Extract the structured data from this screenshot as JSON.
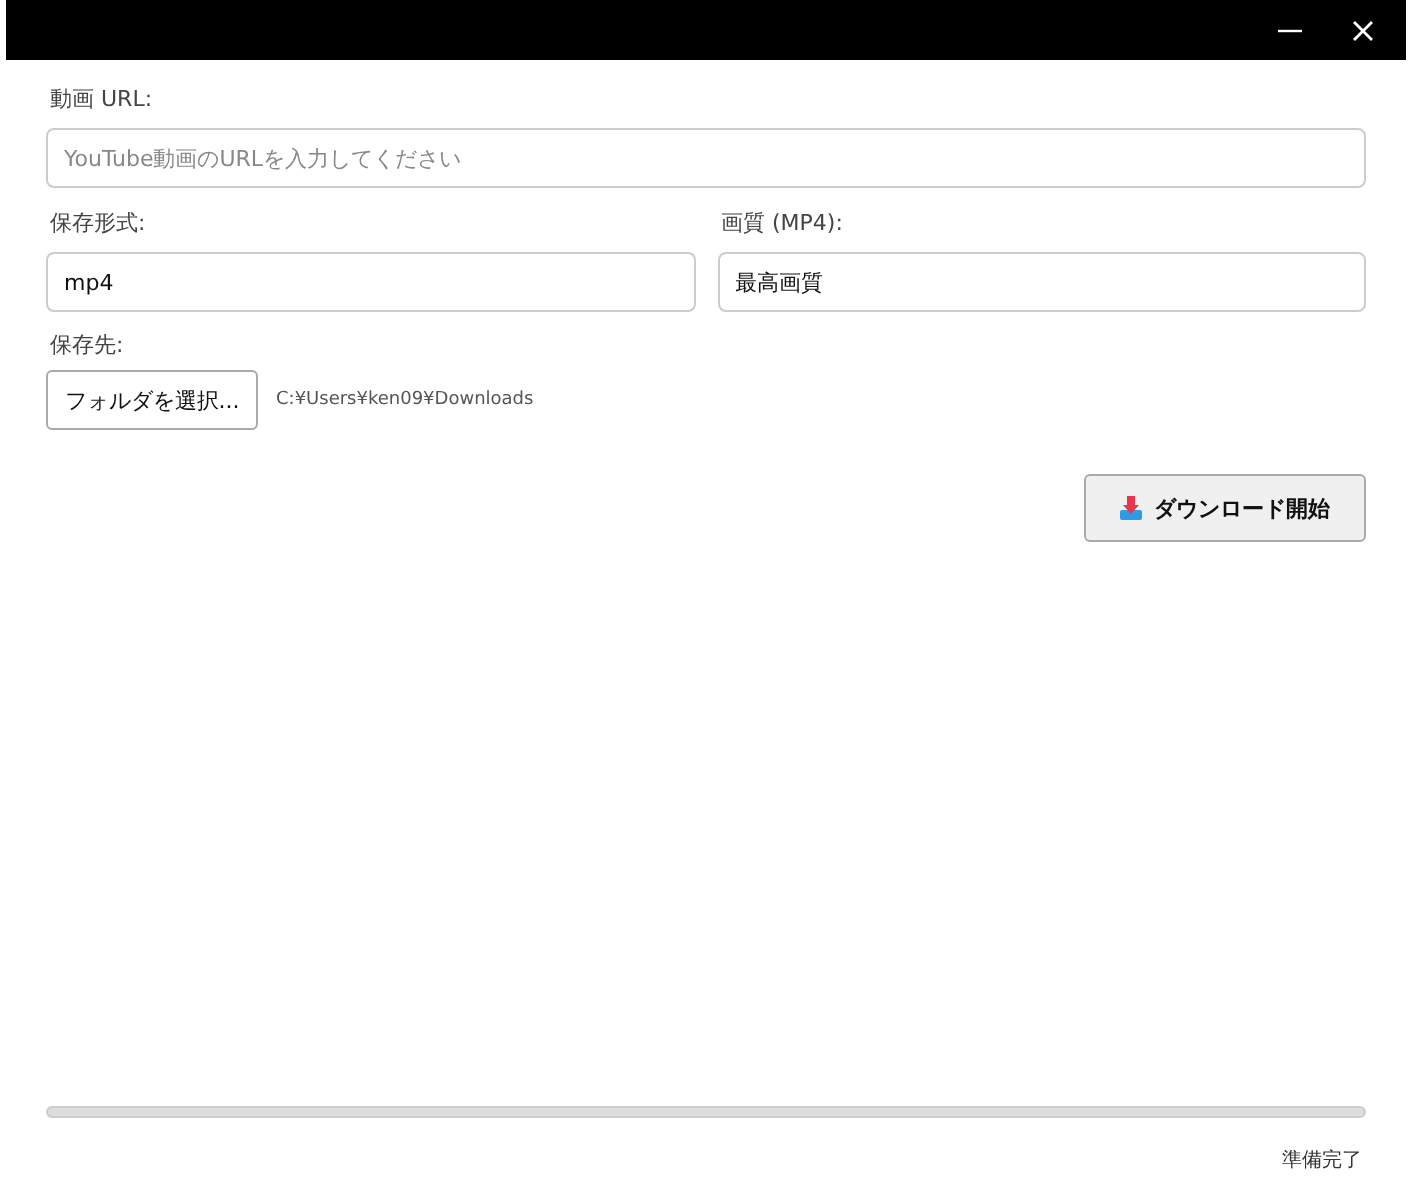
{
  "window": {
    "buttons": [
      {
        "kind": "minimize"
      },
      {
        "kind": "close"
      }
    ]
  },
  "url": {
    "label": "動画 URL:",
    "placeholder": "YouTube動画のURLを入力してください"
  },
  "format": {
    "label": "保存形式:",
    "value": "mp4"
  },
  "quality": {
    "label": "画質 (MP4):",
    "value": "最高画質"
  },
  "destination": {
    "label": "保存先:",
    "button": "フォルダを選択...",
    "path": "C:¥Users¥ken09¥Downloads"
  },
  "download_button": "ダウンロード開始",
  "progress": {
    "level": 0
  },
  "status_bar": "準備完了"
}
